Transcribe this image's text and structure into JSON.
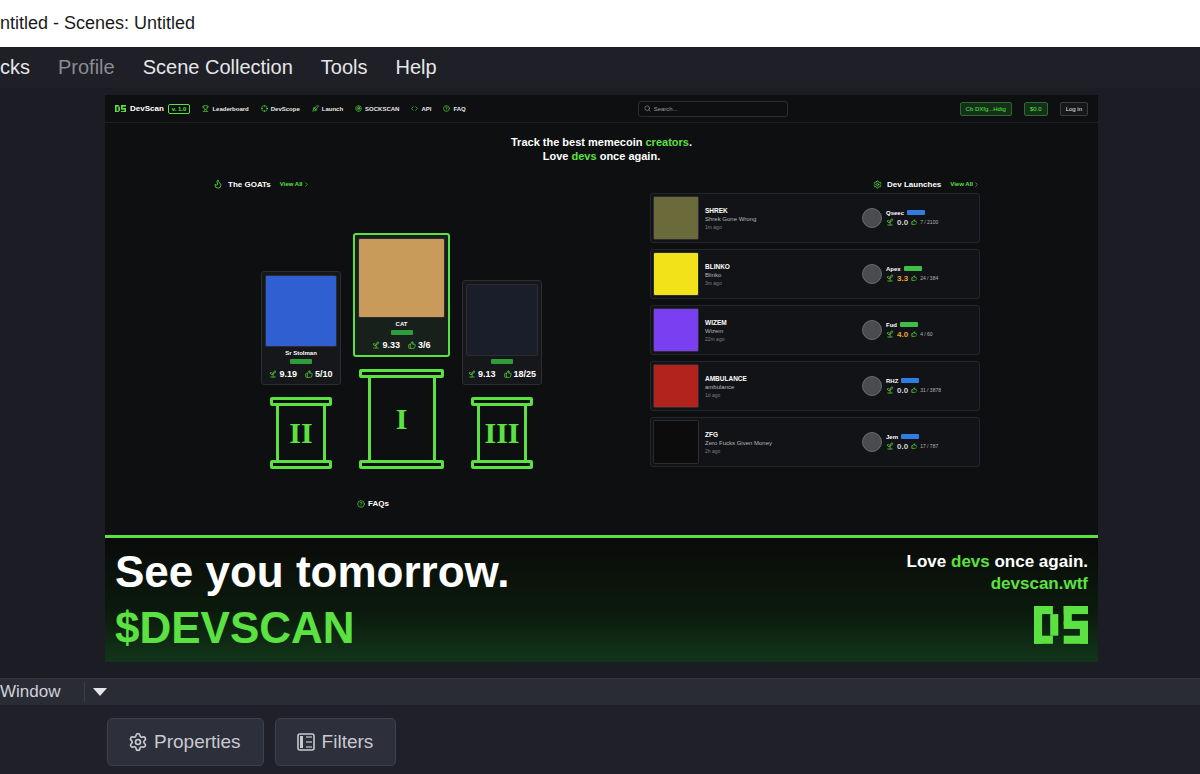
{
  "window": {
    "title": "ntitled - Scenes: Untitled"
  },
  "menu": [
    {
      "label": "cks",
      "disabled": false
    },
    {
      "label": "Profile",
      "disabled": true
    },
    {
      "label": "Scene Collection",
      "disabled": false
    },
    {
      "label": "Tools",
      "disabled": false
    },
    {
      "label": "Help",
      "disabled": false
    }
  ],
  "site": {
    "logo": "DevScan",
    "version": "v. 1.0",
    "nav": [
      "Leaderboard",
      "DevScope",
      "Launch",
      "SOCKSCAN",
      "API",
      "FAQ"
    ],
    "search": {
      "placeholder": "Search..."
    },
    "wallet": "Cb DXfg...Hdtg",
    "balance": "$0.0",
    "login": "Log in",
    "hero": [
      [
        {
          "text": "Track the best memecoin ",
          "accent": false
        },
        {
          "text": "creators",
          "accent": true
        },
        {
          "text": ".",
          "accent": false
        }
      ],
      [
        {
          "text": "Love ",
          "accent": false
        },
        {
          "text": "devs",
          "accent": true
        },
        {
          "text": " once again.",
          "accent": false
        }
      ]
    ],
    "goats": {
      "title": "The GOATs",
      "view_all": "View All",
      "podium": [
        {
          "rank": "II",
          "name": "Sr Stolman",
          "score": "9.19",
          "trials": "5/10",
          "featured": false,
          "color": "#2f5fd0"
        },
        {
          "rank": "I",
          "name": "CAT",
          "score": "9.33",
          "trials": "3/6",
          "featured": true,
          "color": "#c89b5a"
        },
        {
          "rank": "III",
          "score": "9.13",
          "trials": "18/25",
          "featured": false,
          "color": "#1a1d2a"
        }
      ]
    },
    "faqs": "FAQs",
    "launches": {
      "title": "Dev Launches",
      "view_all": "View All",
      "rows": [
        {
          "ticker": "SHREK",
          "name": "Shrek Gone Wrong",
          "age": "1m ago",
          "dev": "Qseec",
          "score": "0.0",
          "count": "7 / 2100",
          "color": "#6b6a3a",
          "score_color": "#cfd2d6",
          "badge_color": "#2f7de1"
        },
        {
          "ticker": "BLINKO",
          "name": "Blinko",
          "age": "3m ago",
          "dev": "Apex",
          "score": "3.3",
          "count": "24 / 384",
          "color": "#f2e21a",
          "score_color": "#e8a33a",
          "badge_color": "#3fbf4a"
        },
        {
          "ticker": "WIZEM",
          "name": "Wizem",
          "age": "22m ago",
          "dev": "Fud",
          "score": "4.0",
          "count": "4 / 60",
          "color": "#7b3ff2",
          "score_color": "#e8a33a",
          "badge_color": "#3fbf4a"
        },
        {
          "ticker": "AMBULANCE",
          "name": "ambulance",
          "age": "1d ago",
          "dev": "RHZ",
          "score": "0.0",
          "count": "31 / 3878",
          "color": "#b3231d",
          "score_color": "#cfd2d6",
          "badge_color": "#2f7de1"
        },
        {
          "ticker": "ZFG",
          "name": "Zero Fucks Given Money",
          "age": "2h ago",
          "dev": "Jem",
          "score": "0.0",
          "count": "17 / 787",
          "color": "#0c0c0c",
          "score_color": "#cfd2d6",
          "badge_color": "#2f7de1"
        }
      ]
    }
  },
  "banner": {
    "headline": "See you tomorrow.",
    "ticker": "$DEVSCAN",
    "tagline": [
      {
        "text": "Love ",
        "accent": false
      },
      {
        "text": "devs",
        "accent": true
      },
      {
        "text": " once again.",
        "accent": false
      }
    ],
    "url": "devscan.wtf"
  },
  "dock": {
    "title": "Window"
  },
  "buttons": [
    {
      "label": "Properties"
    },
    {
      "label": "Filters"
    }
  ]
}
